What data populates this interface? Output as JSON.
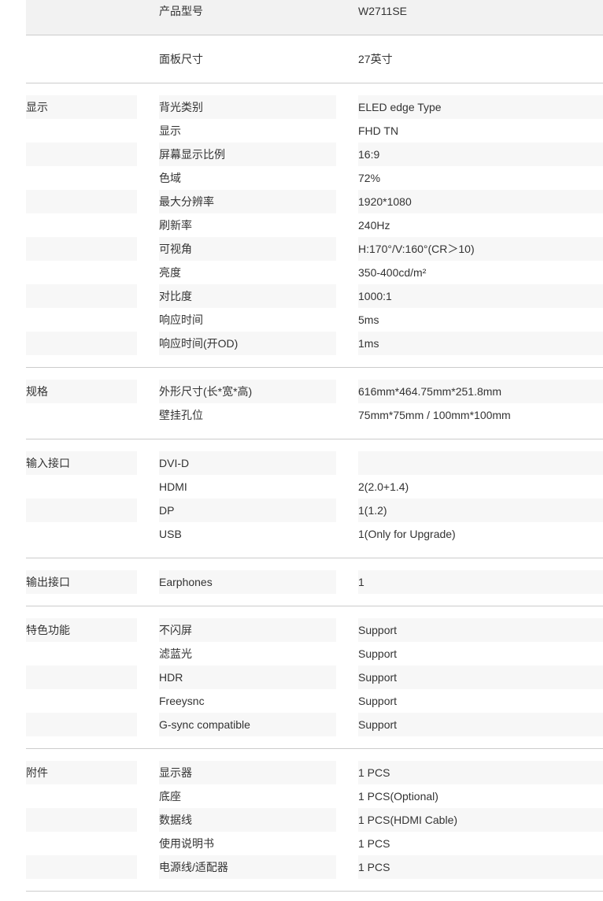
{
  "top_rows": [
    {
      "label": "产品型号",
      "value": "W2711SE"
    },
    {
      "label": "面板尺寸",
      "value": "27英寸"
    }
  ],
  "sections": [
    {
      "title": "显示",
      "rows": [
        {
          "label": "背光类别",
          "value": "ELED edge Type"
        },
        {
          "label": "显示",
          "value": "FHD TN"
        },
        {
          "label": "屏幕显示比例",
          "value": "16:9"
        },
        {
          "label": "色域",
          "value": "72%"
        },
        {
          "label": "最大分辨率",
          "value": "1920*1080"
        },
        {
          "label": "刷新率",
          "value": "240Hz"
        },
        {
          "label": "可视角",
          "value": "H:170°/V:160°(CR＞10)"
        },
        {
          "label": "亮度",
          "value": "350-400cd/m²"
        },
        {
          "label": "对比度",
          "value": "1000:1"
        },
        {
          "label": "响应时间",
          "value": "5ms"
        },
        {
          "label": "响应时间(开OD)",
          "value": "1ms"
        }
      ]
    },
    {
      "title": "规格",
      "rows": [
        {
          "label": "外形尺寸(长*宽*高)",
          "value": "616mm*464.75mm*251.8mm"
        },
        {
          "label": "壁挂孔位",
          "value": "75mm*75mm / 100mm*100mm"
        }
      ]
    },
    {
      "title": "输入接口",
      "rows": [
        {
          "label": "DVI-D",
          "value": ""
        },
        {
          "label": "HDMI",
          "value": "2(2.0+1.4)"
        },
        {
          "label": "DP",
          "value": "1(1.2)"
        },
        {
          "label": "USB",
          "value": "1(Only for Upgrade)"
        }
      ]
    },
    {
      "title": "输出接口",
      "rows": [
        {
          "label": "Earphones",
          "value": "1"
        }
      ]
    },
    {
      "title": "特色功能",
      "rows": [
        {
          "label": "不闪屏",
          "value": "Support"
        },
        {
          "label": "滤蓝光",
          "value": "Support"
        },
        {
          "label": "HDR",
          "value": "Support"
        },
        {
          "label": "Freeysnc",
          "value": "Support"
        },
        {
          "label": "G-sync compatible",
          "value": "Support"
        }
      ]
    },
    {
      "title": "附件",
      "rows": [
        {
          "label": "显示器",
          "value": "1 PCS"
        },
        {
          "label": "底座",
          "value": "1 PCS(Optional)"
        },
        {
          "label": "数据线",
          "value": "1 PCS(HDMI Cable)"
        },
        {
          "label": "使用说明书",
          "value": "1 PCS"
        },
        {
          "label": "电源线/适配器",
          "value": "1 PCS"
        }
      ]
    }
  ]
}
